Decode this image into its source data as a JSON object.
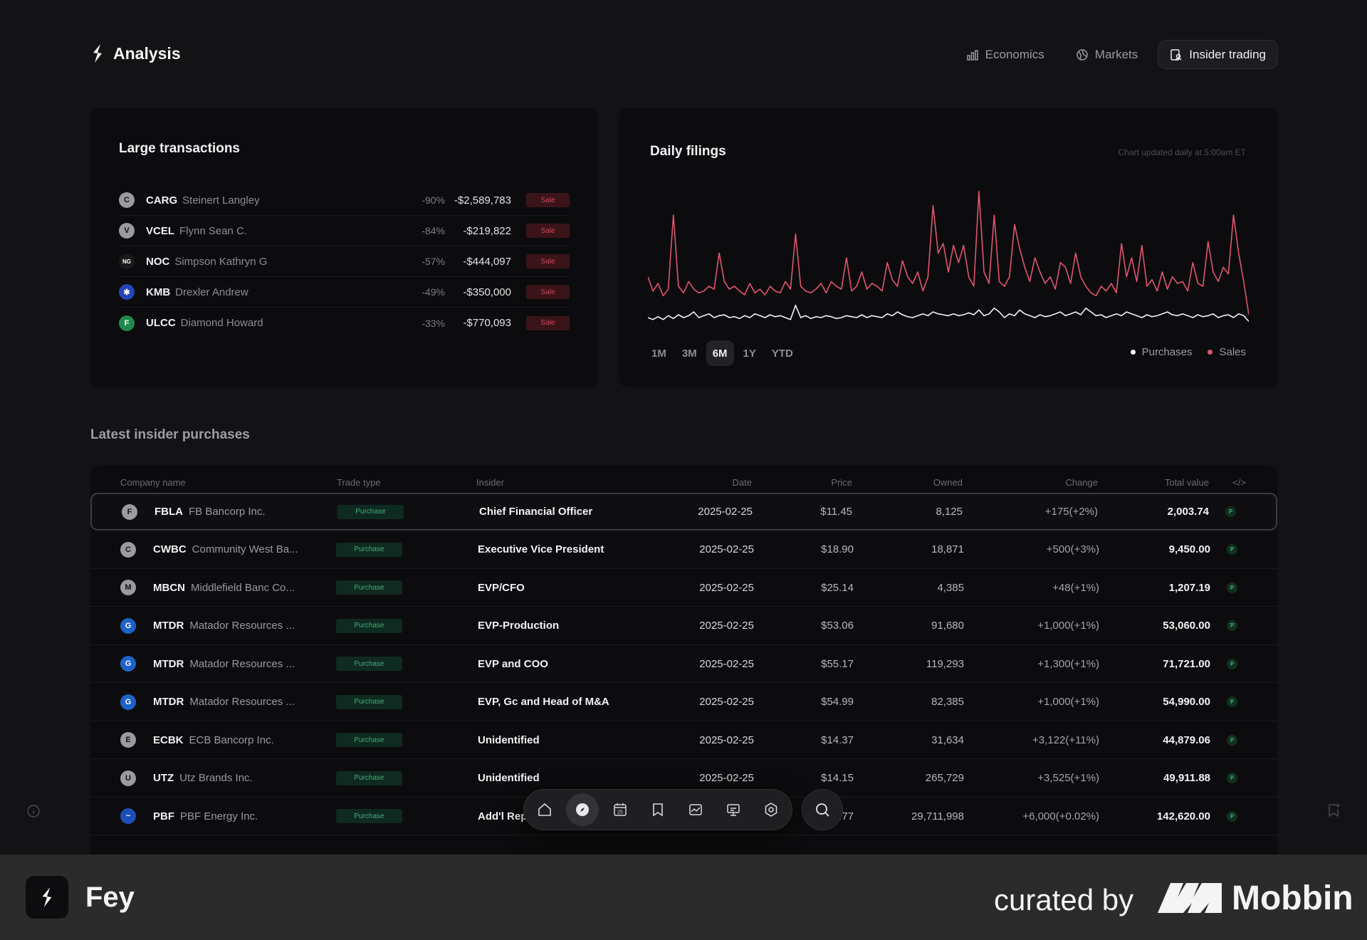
{
  "app": {
    "title": "Analysis"
  },
  "nav": [
    {
      "label": "Economics",
      "icon": "bar-chart-icon",
      "active": false
    },
    {
      "label": "Markets",
      "icon": "globe-icon",
      "active": false
    },
    {
      "label": "Insider trading",
      "icon": "person-doc-icon",
      "active": true
    }
  ],
  "large_transactions": {
    "title": "Large transactions",
    "badge_label": "Sale",
    "rows": [
      {
        "ticker": "CARG",
        "name": "Steinert Langley",
        "pct": "-90%",
        "value": "-$2,589,783",
        "icon_letter": "C",
        "icon_color": "#9a9aa0"
      },
      {
        "ticker": "VCEL",
        "name": "Flynn Sean C.",
        "pct": "-84%",
        "value": "-$219,822",
        "icon_letter": "V",
        "icon_color": "#9a9aa0"
      },
      {
        "ticker": "NOC",
        "name": "Simpson Kathryn G",
        "pct": "-57%",
        "value": "-$444,097",
        "icon_letter": "NG",
        "icon_color": "#1a1a1c"
      },
      {
        "ticker": "KMB",
        "name": "Drexler Andrew",
        "pct": "-49%",
        "value": "-$350,000",
        "icon_letter": "✱",
        "icon_color": "#2446b8"
      },
      {
        "ticker": "ULCC",
        "name": "Diamond Howard",
        "pct": "-33%",
        "value": "-$770,093",
        "icon_letter": "F",
        "icon_color": "#1f8a4c"
      }
    ]
  },
  "daily_filings": {
    "title": "Daily filings",
    "note": "Chart updated daily at 5:00am ET",
    "ranges": [
      "1M",
      "3M",
      "6M",
      "1Y",
      "YTD"
    ],
    "active_range": "6M",
    "legend": [
      {
        "label": "Purchases",
        "color": "#f2f2f4"
      },
      {
        "label": "Sales",
        "color": "#e0566e"
      }
    ]
  },
  "chart_data": {
    "type": "line",
    "title": "Daily filings",
    "xlabel": "",
    "ylabel": "",
    "ylim": [
      0,
      150
    ],
    "grid": false,
    "legend_position": "bottom-right",
    "series": [
      {
        "name": "Sales",
        "color": "#e0566e",
        "values": [
          55,
          40,
          48,
          35,
          42,
          120,
          45,
          38,
          50,
          42,
          38,
          40,
          45,
          42,
          80,
          50,
          42,
          45,
          40,
          36,
          48,
          38,
          42,
          36,
          45,
          40,
          38,
          50,
          42,
          100,
          45,
          40,
          38,
          42,
          48,
          38,
          50,
          45,
          42,
          75,
          40,
          45,
          60,
          42,
          48,
          45,
          40,
          70,
          52,
          45,
          72,
          55,
          48,
          60,
          40,
          55,
          130,
          80,
          90,
          60,
          88,
          70,
          88,
          55,
          45,
          145,
          60,
          48,
          120,
          50,
          45,
          55,
          110,
          85,
          65,
          50,
          75,
          60,
          48,
          55,
          42,
          70,
          65,
          48,
          80,
          55,
          45,
          38,
          35,
          45,
          40,
          48,
          38,
          90,
          55,
          75,
          50,
          88,
          45,
          52,
          40,
          60,
          42,
          55,
          48,
          50,
          40,
          70,
          48,
          45,
          92,
          60,
          50,
          65,
          58,
          120,
          80,
          50,
          15
        ]
      },
      {
        "name": "Purchases",
        "color": "#f2f2f4",
        "values": [
          12,
          10,
          13,
          10,
          14,
          11,
          15,
          12,
          14,
          18,
          12,
          14,
          16,
          12,
          14,
          15,
          12,
          13,
          11,
          14,
          12,
          16,
          14,
          12,
          15,
          13,
          14,
          12,
          10,
          25,
          12,
          14,
          11,
          13,
          12,
          14,
          13,
          11,
          12,
          14,
          13,
          12,
          15,
          12,
          14,
          13,
          12,
          16,
          14,
          18,
          15,
          13,
          12,
          14,
          16,
          14,
          18,
          16,
          15,
          14,
          16,
          14,
          15,
          17,
          15,
          20,
          14,
          16,
          22,
          18,
          12,
          16,
          14,
          20,
          16,
          14,
          12,
          15,
          13,
          14,
          16,
          18,
          14,
          16,
          18,
          15,
          22,
          18,
          14,
          15,
          12,
          14,
          16,
          14,
          18,
          16,
          14,
          12,
          15,
          13,
          14,
          16,
          18,
          15,
          14,
          16,
          14,
          12,
          15,
          13,
          14,
          16,
          12,
          14,
          15,
          12,
          16,
          14,
          8
        ]
      }
    ]
  },
  "latest_purchases": {
    "title": "Latest insider purchases",
    "columns": [
      "Company name",
      "Trade type",
      "Insider",
      "Date",
      "Price",
      "Owned",
      "Change",
      "Total value",
      "</>"
    ],
    "badge_label": "Purchase",
    "p_label": "P",
    "rows": [
      {
        "ticker": "FBLA",
        "company": "FB Bancorp Inc.",
        "insider": "Chief Financial Officer",
        "date": "2025-02-25",
        "price": "$11.45",
        "owned": "8,125",
        "change": "+175(+2%)",
        "total": "2,003.74",
        "icon_letter": "F",
        "icon_color": "#9a9aa0"
      },
      {
        "ticker": "CWBC",
        "company": "Community West Ba...",
        "insider": "Executive Vice President",
        "date": "2025-02-25",
        "price": "$18.90",
        "owned": "18,871",
        "change": "+500(+3%)",
        "total": "9,450.00",
        "icon_letter": "C",
        "icon_color": "#9a9aa0"
      },
      {
        "ticker": "MBCN",
        "company": "Middlefield Banc Co...",
        "insider": "EVP/CFO",
        "date": "2025-02-25",
        "price": "$25.14",
        "owned": "4,385",
        "change": "+48(+1%)",
        "total": "1,207.19",
        "icon_letter": "M",
        "icon_color": "#9a9aa0"
      },
      {
        "ticker": "MTDR",
        "company": "Matador Resources ...",
        "insider": "EVP-Production",
        "date": "2025-02-25",
        "price": "$53.06",
        "owned": "91,680",
        "change": "+1,000(+1%)",
        "total": "53,060.00",
        "icon_letter": "G",
        "icon_color": "#1e62c8"
      },
      {
        "ticker": "MTDR",
        "company": "Matador Resources ...",
        "insider": "EVP and COO",
        "date": "2025-02-25",
        "price": "$55.17",
        "owned": "119,293",
        "change": "+1,300(+1%)",
        "total": "71,721.00",
        "icon_letter": "G",
        "icon_color": "#1e62c8"
      },
      {
        "ticker": "MTDR",
        "company": "Matador Resources ...",
        "insider": "EVP, Gc and Head of M&A",
        "date": "2025-02-25",
        "price": "$54.99",
        "owned": "82,385",
        "change": "+1,000(+1%)",
        "total": "54,990.00",
        "icon_letter": "G",
        "icon_color": "#1e62c8"
      },
      {
        "ticker": "ECBK",
        "company": "ECB Bancorp Inc.",
        "insider": "Unidentified",
        "date": "2025-02-25",
        "price": "$14.37",
        "owned": "31,634",
        "change": "+3,122(+11%)",
        "total": "44,879.06",
        "icon_letter": "E",
        "icon_color": "#9a9aa0"
      },
      {
        "ticker": "UTZ",
        "company": "Utz Brands Inc.",
        "insider": "Unidentified",
        "date": "2025-02-25",
        "price": "$14.15",
        "owned": "265,729",
        "change": "+3,525(+1%)",
        "total": "49,911.88",
        "icon_letter": "U",
        "icon_color": "#9a9aa0"
      },
      {
        "ticker": "PBF",
        "company": "PBF Energy Inc.",
        "insider": "Add'l Rep.",
        "date": "",
        "price": "...77",
        "owned": "29,711,998",
        "change": "+6,000(+0.02%)",
        "total": "142,620.00",
        "icon_letter": "~",
        "icon_color": "#1e4fb8"
      }
    ]
  },
  "dock": [
    {
      "icon": "home-icon",
      "active": false
    },
    {
      "icon": "compass-icon",
      "active": true
    },
    {
      "icon": "calendar-icon",
      "active": false,
      "label": "25"
    },
    {
      "icon": "bookmark-icon",
      "active": false
    },
    {
      "icon": "image-chart-icon",
      "active": false
    },
    {
      "icon": "presentation-icon",
      "active": false
    },
    {
      "icon": "settings-icon",
      "active": false
    }
  ],
  "footer": {
    "app_name": "Fey",
    "curated_by": "curated by",
    "brand": "Mobbin"
  }
}
